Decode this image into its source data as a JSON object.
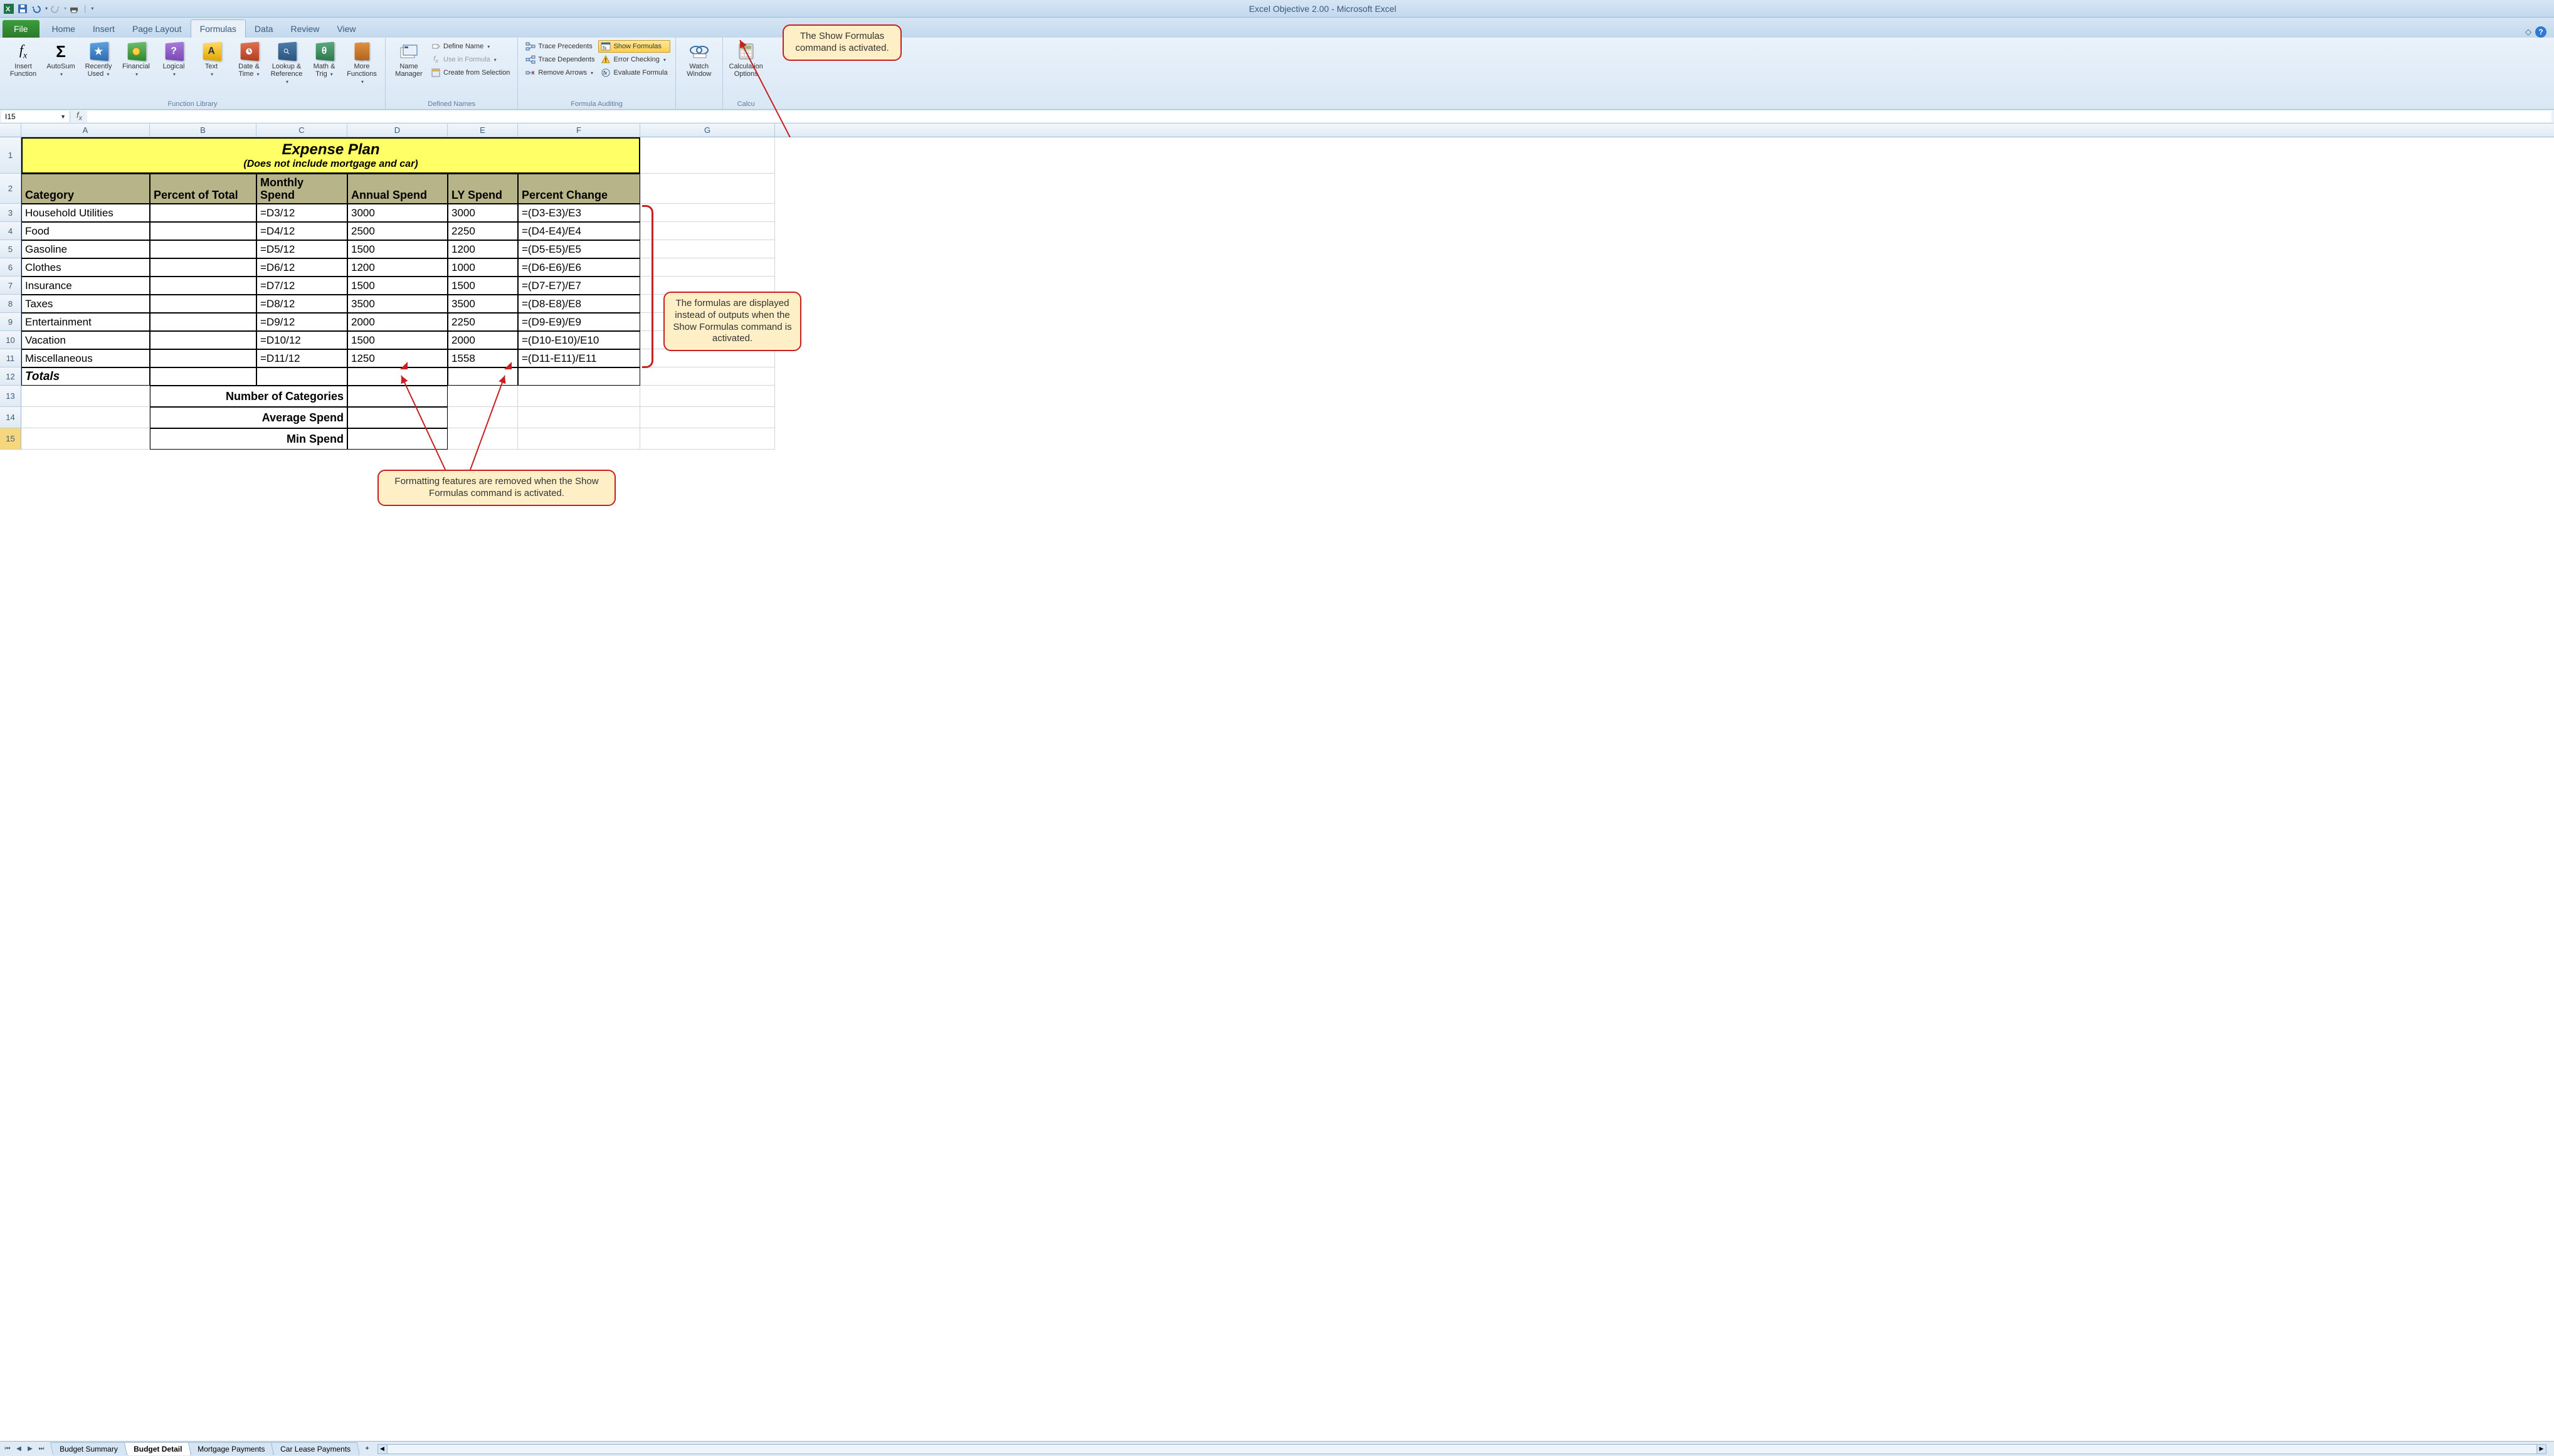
{
  "window": {
    "title": "Excel Objective 2.00 - Microsoft Excel"
  },
  "tabs": {
    "file": "File",
    "home": "Home",
    "insert": "Insert",
    "pageLayout": "Page Layout",
    "formulas": "Formulas",
    "data": "Data",
    "review": "Review",
    "view": "View"
  },
  "ribbon": {
    "insertFunction": "Insert\nFunction",
    "autoSum": "AutoSum",
    "recentlyUsed": "Recently\nUsed",
    "financial": "Financial",
    "logical": "Logical",
    "text": "Text",
    "dateTime": "Date &\nTime",
    "lookupRef": "Lookup &\nReference",
    "mathTrig": "Math &\nTrig",
    "moreFunctions": "More\nFunctions",
    "functionLibrary": "Function Library",
    "nameManager": "Name\nManager",
    "defineName": "Define Name",
    "useInFormula": "Use in Formula",
    "createFromSelection": "Create from Selection",
    "definedNames": "Defined Names",
    "tracePrecedents": "Trace Precedents",
    "traceDependents": "Trace Dependents",
    "removeArrows": "Remove Arrows",
    "showFormulas": "Show Formulas",
    "errorChecking": "Error Checking",
    "evaluateFormula": "Evaluate Formula",
    "formulaAuditing": "Formula Auditing",
    "watchWindow": "Watch\nWindow",
    "calcOptions": "Calculation\nOptions",
    "calcGroup": "Calcu"
  },
  "nameBox": "I15",
  "columns": [
    "A",
    "B",
    "C",
    "D",
    "E",
    "F",
    "G"
  ],
  "sheet": {
    "title": "Expense Plan",
    "subtitle": "(Does not include mortgage and car)",
    "headers": {
      "category": "Category",
      "percentOfTotal": "Percent of Total",
      "monthlySpend": "Monthly Spend",
      "annualSpend": "Annual Spend",
      "lySpend": "LY Spend",
      "percentChange": "Percent Change"
    },
    "rows": [
      {
        "n": 3,
        "cat": "Household Utilities",
        "b": "",
        "c": "=D3/12",
        "d": "3000",
        "e": "3000",
        "f": "=(D3-E3)/E3"
      },
      {
        "n": 4,
        "cat": "Food",
        "b": "",
        "c": "=D4/12",
        "d": "2500",
        "e": "2250",
        "f": "=(D4-E4)/E4"
      },
      {
        "n": 5,
        "cat": "Gasoline",
        "b": "",
        "c": "=D5/12",
        "d": "1500",
        "e": "1200",
        "f": "=(D5-E5)/E5"
      },
      {
        "n": 6,
        "cat": "Clothes",
        "b": "",
        "c": "=D6/12",
        "d": "1200",
        "e": "1000",
        "f": "=(D6-E6)/E6"
      },
      {
        "n": 7,
        "cat": "Insurance",
        "b": "",
        "c": "=D7/12",
        "d": "1500",
        "e": "1500",
        "f": "=(D7-E7)/E7"
      },
      {
        "n": 8,
        "cat": "Taxes",
        "b": "",
        "c": "=D8/12",
        "d": "3500",
        "e": "3500",
        "f": "=(D8-E8)/E8"
      },
      {
        "n": 9,
        "cat": "Entertainment",
        "b": "",
        "c": "=D9/12",
        "d": "2000",
        "e": "2250",
        "f": "=(D9-E9)/E9"
      },
      {
        "n": 10,
        "cat": "Vacation",
        "b": "",
        "c": "=D10/12",
        "d": "1500",
        "e": "2000",
        "f": "=(D10-E10)/E10"
      },
      {
        "n": 11,
        "cat": "Miscellaneous",
        "b": "",
        "c": "=D11/12",
        "d": "1250",
        "e": "1558",
        "f": "=(D11-E11)/E11"
      }
    ],
    "totals": "Totals",
    "summary": {
      "numCategories": "Number of Categories",
      "avgSpend": "Average Spend",
      "minSpend": "Min Spend"
    }
  },
  "sheetTabs": [
    "Budget Summary",
    "Budget Detail",
    "Mortgage Payments",
    "Car Lease Payments"
  ],
  "activeSheetTab": 1,
  "callouts": {
    "c1": "The Show Formulas command is activated.",
    "c2": "The formulas are displayed instead of outputs when the Show Formulas command is activated.",
    "c3": "Formatting features are removed when the Show Formulas command is activated."
  }
}
